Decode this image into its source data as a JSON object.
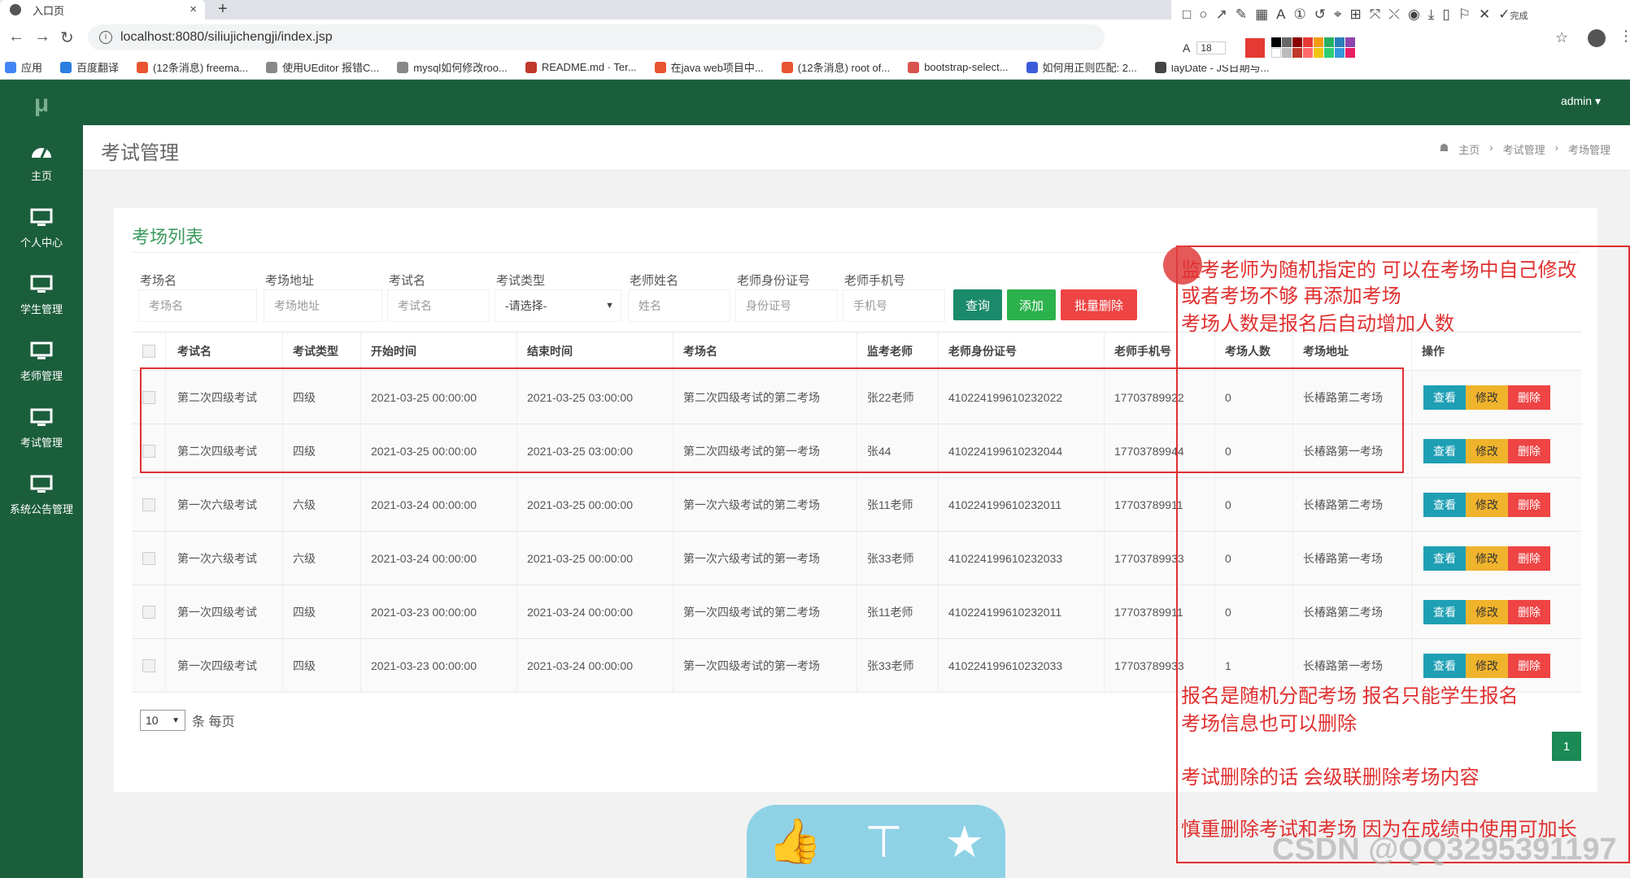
{
  "browser": {
    "tab_title": "入口页",
    "url": "localhost:8080/siliujichengji/index.jsp",
    "bookmarks": [
      "应用",
      "百度翻译",
      "(12条消息) freema...",
      "使用UEditor 报错C...",
      "mysql如何修改roo...",
      "README.md · Ter...",
      "在java web项目中...",
      "(12条消息) root of...",
      "bootstrap-select...",
      "如何用正则匹配: 2...",
      "layDate - JS日期与..."
    ],
    "font_size": "18",
    "done_label": "完成"
  },
  "sidebar": {
    "logo": "μ",
    "items": [
      {
        "label": "主页",
        "icon": "dashboard-icon"
      },
      {
        "label": "个人中心",
        "icon": "monitor-icon"
      },
      {
        "label": "学生管理",
        "icon": "monitor-icon"
      },
      {
        "label": "老师管理",
        "icon": "monitor-icon"
      },
      {
        "label": "考试管理",
        "icon": "monitor-icon"
      },
      {
        "label": "系统公告管理",
        "icon": "monitor-icon"
      }
    ]
  },
  "header": {
    "user": "admin ▾"
  },
  "page": {
    "title": "考试管理",
    "breadcrumb": [
      "主页",
      "考试管理",
      "考场管理"
    ]
  },
  "card": {
    "title": "考场列表"
  },
  "filters": [
    {
      "label": "考场名",
      "placeholder": "考场名"
    },
    {
      "label": "考场地址",
      "placeholder": "考场地址"
    },
    {
      "label": "考试名",
      "placeholder": "考试名"
    },
    {
      "label": "考试类型",
      "placeholder": "-请选择-"
    },
    {
      "label": "老师姓名",
      "placeholder": "姓名"
    },
    {
      "label": "老师身份证号",
      "placeholder": "身份证号"
    },
    {
      "label": "老师手机号",
      "placeholder": "手机号"
    }
  ],
  "buttons": {
    "search": "查询",
    "add": "添加",
    "batch_delete": "批量删除"
  },
  "table": {
    "columns": [
      "考试名",
      "考试类型",
      "开始时间",
      "结束时间",
      "考场名",
      "监考老师",
      "老师身份证号",
      "老师手机号",
      "考场人数",
      "考场地址",
      "操作"
    ],
    "rows": [
      [
        "第二次四级考试",
        "四级",
        "2021-03-25 00:00:00",
        "2021-03-25 03:00:00",
        "第二次四级考试的第二考场",
        "张22老师",
        "410224199610232022",
        "17703789922",
        "0",
        "长椿路第二考场"
      ],
      [
        "第二次四级考试",
        "四级",
        "2021-03-25 00:00:00",
        "2021-03-25 03:00:00",
        "第二次四级考试的第一考场",
        "张44",
        "410224199610232044",
        "17703789944",
        "0",
        "长椿路第一考场"
      ],
      [
        "第一次六级考试",
        "六级",
        "2021-03-24 00:00:00",
        "2021-03-25 00:00:00",
        "第一次六级考试的第二考场",
        "张11老师",
        "410224199610232011",
        "17703789911",
        "0",
        "长椿路第二考场"
      ],
      [
        "第一次六级考试",
        "六级",
        "2021-03-24 00:00:00",
        "2021-03-25 00:00:00",
        "第一次六级考试的第一考场",
        "张33老师",
        "410224199610232033",
        "17703789933",
        "0",
        "长椿路第一考场"
      ],
      [
        "第一次四级考试",
        "四级",
        "2021-03-23 00:00:00",
        "2021-03-24 00:00:00",
        "第一次四级考试的第二考场",
        "张11老师",
        "410224199610232011",
        "17703789911",
        "0",
        "长椿路第二考场"
      ],
      [
        "第一次四级考试",
        "四级",
        "2021-03-23 00:00:00",
        "2021-03-24 00:00:00",
        "第一次四级考试的第一考场",
        "张33老师",
        "410224199610232033",
        "17703789933",
        "1",
        "长椿路第一考场"
      ]
    ],
    "actions": {
      "view": "查看",
      "edit": "修改",
      "delete": "删除"
    }
  },
  "pager": {
    "page_size": "10",
    "suffix": "条 每页",
    "current_page": "1"
  },
  "annotations": [
    "监考老师为随机指定的  可以在考场中自己修改",
    "或者考场不够 再添加考场",
    "考场人数是报名后自动增加人数",
    "报名是随机分配考场 报名只能学生报名",
    "考场信息也可以删除",
    "考试删除的话  会级联删除考场内容",
    "慎重删除考试和考场  因为在成绩中使用可加长"
  ],
  "watermark": "CSDN @QQ3295391197",
  "colors": {
    "sidebar": "#1b5e3c",
    "accent": "#3a9a5c",
    "annotation": "#e03030"
  }
}
